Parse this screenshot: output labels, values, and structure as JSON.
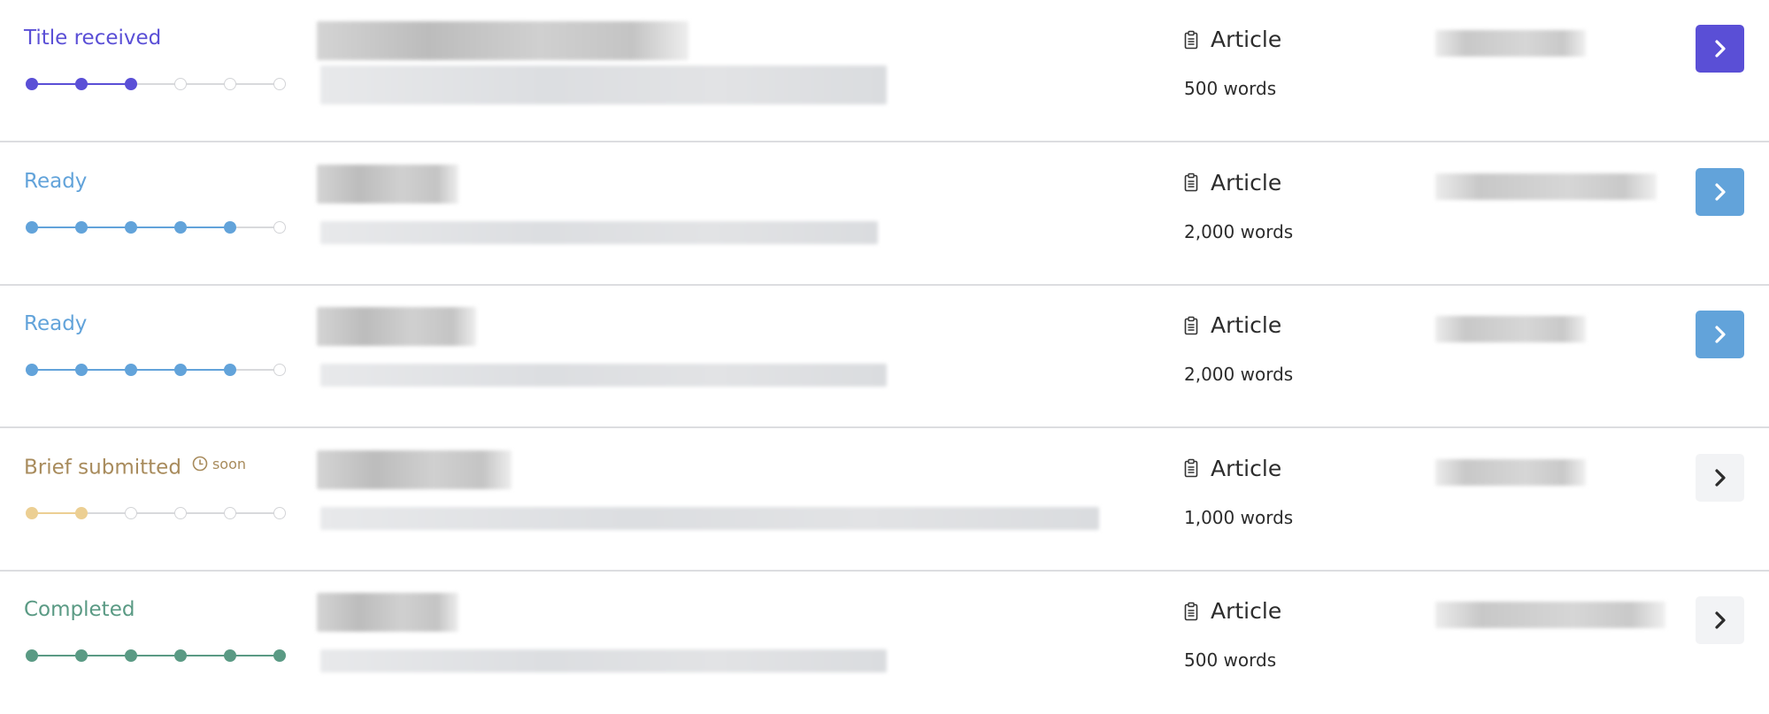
{
  "rows": [
    {
      "status": "Title received",
      "soon": "",
      "status_color": "#5a4fd6",
      "dot_color": "#5a4fd6",
      "steps_done": 3,
      "steps_total": 6,
      "type": "Article",
      "words": "500 words",
      "button_bg": "#5a4fd6",
      "button_fg": "#ffffff",
      "icon": "chevron-right-icon"
    },
    {
      "status": "Ready",
      "soon": "",
      "status_color": "#62a3da",
      "dot_color": "#62a3da",
      "steps_done": 5,
      "steps_total": 6,
      "type": "Article",
      "words": "2,000 words",
      "button_bg": "#62a3da",
      "button_fg": "#ffffff",
      "icon": "chevron-right-icon"
    },
    {
      "status": "Ready",
      "soon": "",
      "status_color": "#62a3da",
      "dot_color": "#62a3da",
      "steps_done": 5,
      "steps_total": 6,
      "type": "Article",
      "words": "2,000 words",
      "button_bg": "#62a3da",
      "button_fg": "#ffffff",
      "icon": "chevron-right-icon"
    },
    {
      "status": "Brief submitted",
      "soon": "soon",
      "status_color": "#a88b5c",
      "dot_color": "#eccf93",
      "steps_done": 2,
      "steps_total": 6,
      "type": "Article",
      "words": "1,000 words",
      "button_bg": "#f2f3f5",
      "button_fg": "#2c2c2c",
      "icon": "chevron-right-icon"
    },
    {
      "status": "Completed",
      "soon": "",
      "status_color": "#5a9a84",
      "dot_color": "#5a9a84",
      "steps_done": 6,
      "steps_total": 6,
      "type": "Article",
      "words": "500 words",
      "button_bg": "#f2f3f5",
      "button_fg": "#2c2c2c",
      "icon": "chevron-right-icon"
    }
  ]
}
